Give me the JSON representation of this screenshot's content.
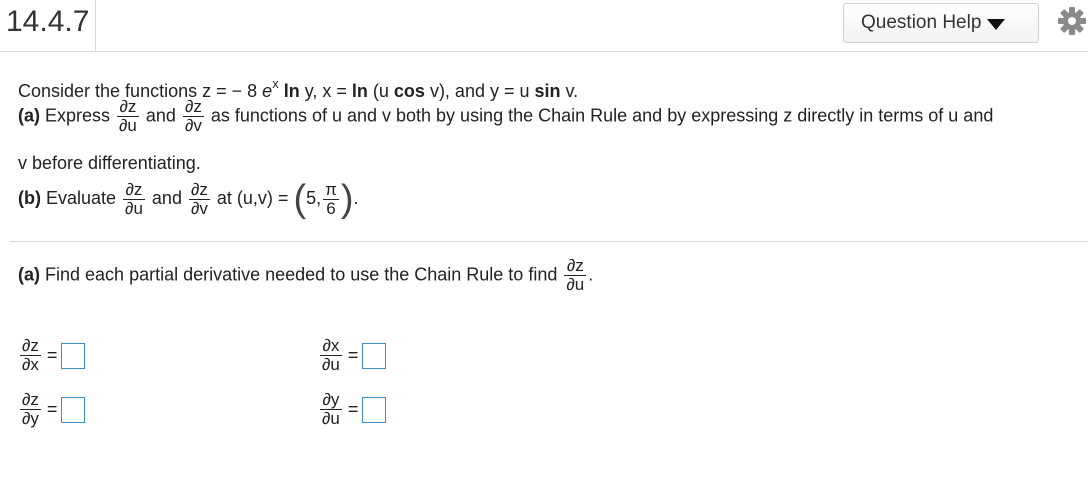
{
  "header": {
    "problem_number": "14.4.7",
    "question_help_label": "Question Help",
    "icons": {
      "dropdown": "caret-down-icon",
      "settings": "gear-icon"
    }
  },
  "prompt": {
    "intro_prefix": "Consider the functions z = ",
    "z_expr_a": "− 8",
    "z_expr_e": "e",
    "z_expr_sup": "x",
    "z_ln": "ln",
    "z_y": " y, x = ",
    "x_ln": "ln",
    "x_paren_open": " (u ",
    "x_cos": "cos",
    "x_rest": " v), and y = u ",
    "y_sin": "sin",
    "y_end": " v.",
    "part_a_label": "(a)",
    "part_a_word": " Express ",
    "dz": "∂z",
    "du": "∂u",
    "dv": "∂v",
    "and": "and",
    "part_a_rest": "as functions of u and v both by using the Chain Rule and by expressing z directly in terms of u and",
    "part_a_cont": "v before differentiating.",
    "part_b_label": "(b)",
    "part_b_word": " Evaluate ",
    "part_b_at": "at (u,v) = ",
    "point_u": "5,",
    "point_v_num": "π",
    "point_v_den": "6",
    "period": "."
  },
  "question": {
    "text": "Find each partial derivative needed to use the Chain Rule to find",
    "label": "(a)",
    "target_num": "∂z",
    "target_den": "∂u",
    "target_end": "."
  },
  "answers": [
    {
      "num": "∂z",
      "den": "∂x",
      "eq": "="
    },
    {
      "num": "∂x",
      "den": "∂u",
      "eq": "="
    },
    {
      "num": "∂z",
      "den": "∂y",
      "eq": "="
    },
    {
      "num": "∂y",
      "den": "∂u",
      "eq": "="
    }
  ],
  "colors": {
    "answer_box_border": "#3d8fc9",
    "divider": "#d8d8d8"
  }
}
